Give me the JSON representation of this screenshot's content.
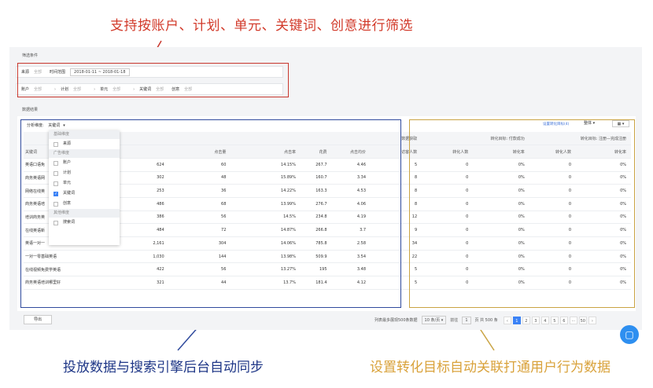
{
  "captions": {
    "top": "支持按账户、计划、单元、关键词、创意进行筛选",
    "bottom_left": "投放数据与搜索引擎后台自动同步",
    "bottom_right": "设置转化目标自动关联打通用户行为数据"
  },
  "filter": {
    "section_title": "筛选条件",
    "source_label": "来源",
    "source_value": "全部",
    "time_label": "时间范围",
    "date_range": "2018-01-11 ~ 2018-01-18",
    "account_label": "账户",
    "account_value": "全部",
    "plan_label": "计划",
    "plan_value": "全部",
    "unit_label": "单元",
    "unit_value": "全部",
    "keyword_label": "关键词",
    "keyword_value": "全部",
    "creative_label": "创意",
    "creative_value": "全部",
    "arrow": "›"
  },
  "results": {
    "section_title": "数据结果",
    "dimension_label": "分析维度:",
    "dimension_value": "关键词",
    "settings_link": "设置转化目标(4)",
    "view_select": "整体",
    "layout_icon": "layout-grid-icon"
  },
  "dropdown": {
    "groups": [
      {
        "title": "基础维度",
        "options": [
          {
            "label": "来源",
            "checked": false
          }
        ]
      },
      {
        "title": "广告维度",
        "options": [
          {
            "label": "账户",
            "checked": false
          },
          {
            "label": "计划",
            "checked": false
          },
          {
            "label": "单元",
            "checked": false
          },
          {
            "label": "关键词",
            "checked": true
          },
          {
            "label": "创意",
            "checked": false
          }
        ]
      },
      {
        "title": "其他维度",
        "options": [
          {
            "label": "搜索词",
            "checked": false
          }
        ]
      }
    ]
  },
  "table": {
    "group_headers": {
      "acquire": "数据获取",
      "conv1": "转化目标: 付款成功",
      "conv2": "转化目标: 注册—完成注册"
    },
    "columns": [
      "关键词",
      "",
      "",
      "点击量",
      "点击率",
      "花费",
      "点击均价",
      "访客人数",
      "转化人数",
      "转化率",
      "转化人数",
      "转化率"
    ],
    "rows": [
      [
        "英语口语免",
        "",
        "624",
        "60",
        "14.15%",
        "267.7",
        "4.46",
        "5",
        "0",
        "0%",
        "0",
        "0%"
      ],
      [
        "商务英语网",
        "",
        "302",
        "48",
        "15.89%",
        "160.7",
        "3.34",
        "8",
        "0",
        "0%",
        "0",
        "0%"
      ],
      [
        "网络在线英",
        "",
        "253",
        "36",
        "14.22%",
        "163.3",
        "4.53",
        "8",
        "0",
        "0%",
        "0",
        "0%"
      ],
      [
        "商务英语培",
        "",
        "486",
        "68",
        "13.99%",
        "276.7",
        "4.06",
        "8",
        "0",
        "0%",
        "0",
        "0%"
      ],
      [
        "培训商务英",
        "",
        "386",
        "56",
        "14.5%",
        "234.8",
        "4.19",
        "12",
        "0",
        "0%",
        "0",
        "0%"
      ],
      [
        "在线英语新",
        "",
        "484",
        "72",
        "14.87%",
        "266.8",
        "3.7",
        "9",
        "0",
        "0%",
        "0",
        "0%"
      ],
      [
        "英语一对一",
        "",
        "2,161",
        "304",
        "14.06%",
        "785.8",
        "2.58",
        "34",
        "0",
        "0%",
        "0",
        "0%"
      ],
      [
        "一对一零基础英语",
        "",
        "1,030",
        "144",
        "13.98%",
        "509.9",
        "3.54",
        "22",
        "0",
        "0%",
        "0",
        "0%"
      ],
      [
        "在线视频免费学英语",
        "",
        "422",
        "56",
        "13.27%",
        "195",
        "3.48",
        "5",
        "0",
        "0%",
        "0",
        "0%"
      ],
      [
        "商务英语培训哪里好",
        "",
        "321",
        "44",
        "13.7%",
        "181.4",
        "4.12",
        "5",
        "0",
        "0%",
        "0",
        "0%"
      ]
    ]
  },
  "footer": {
    "export_label": "导出",
    "hint": "列表最多展现500条数据",
    "page_size": "10 条/页",
    "jump_label": "前往",
    "jump_value": "1",
    "total": "页 共 500 条",
    "pages": [
      "‹",
      "1",
      "2",
      "3",
      "4",
      "5",
      "6",
      "···",
      "50",
      "›"
    ],
    "current_page": "1"
  },
  "colors": {
    "red": "#c8372d",
    "blue": "#2f4a9d",
    "gold": "#c9a343",
    "accent": "#3b82f6"
  }
}
